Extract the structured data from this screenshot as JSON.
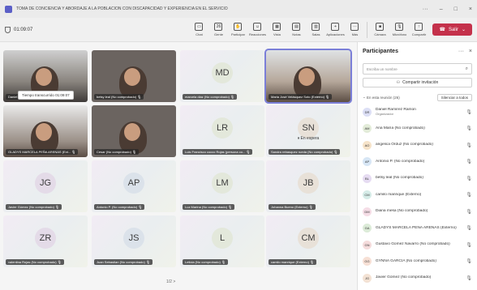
{
  "window": {
    "title": "TOMA DE CONCIENCIA Y ABORDAJE A LA POBLACIÓN CON DISCAPACIDAD Y EXPERIENCIA EN EL SERVICIO",
    "controls": {
      "more": "···",
      "minimize": "–",
      "maximize": "□",
      "close": "×"
    }
  },
  "toolbar": {
    "timer": "01:09:07",
    "buttons": [
      {
        "label": "Chat",
        "icon": "chat-icon",
        "glyph": "▭"
      },
      {
        "label": "Gente",
        "icon": "people-icon",
        "glyph": "26"
      },
      {
        "label": "Participar",
        "icon": "raise-hand-icon",
        "glyph": "✋"
      },
      {
        "label": "Reacciones",
        "icon": "smile-icon",
        "glyph": "☺"
      },
      {
        "label": "Vista",
        "icon": "grid-view-icon",
        "glyph": "▦"
      },
      {
        "label": "Notas",
        "icon": "notes-icon",
        "glyph": "▤"
      },
      {
        "label": "Salas",
        "icon": "rooms-icon",
        "glyph": "▥"
      },
      {
        "label": "Aplicaciones",
        "icon": "apps-icon",
        "glyph": "+"
      },
      {
        "label": "Más",
        "icon": "more-icon",
        "glyph": "···"
      }
    ],
    "devices": [
      {
        "label": "Cámara",
        "icon": "camera-icon",
        "glyph": "■"
      },
      {
        "label": "Micrófono",
        "icon": "microphone-icon",
        "glyph": "🎙"
      },
      {
        "label": "Compartir",
        "icon": "share-icon",
        "glyph": "↑"
      }
    ],
    "leave_label": "Salir",
    "leave_caret": "⌄"
  },
  "grid": {
    "tooltip": "Tiempo transcurrido 01:09:07",
    "waiting_label": "En espera",
    "pager": "1/2 >",
    "tiles": [
      {
        "name": "Daniel Ramírez Ramon",
        "initials": ""
      },
      {
        "name": "betsy leal (No comprobado)",
        "initials": ""
      },
      {
        "name": "marcela diaz (No comprobado)",
        "initials": "MD"
      },
      {
        "name": "Maria José Velásquez Soto (Externo)",
        "initials": ""
      },
      {
        "name": "GLADYS MARCELA PEÑA ARENAS (Ext...",
        "initials": ""
      },
      {
        "name": "Cesar (No comprobado)",
        "initials": ""
      },
      {
        "name": "Luis Francisco cocco Rojas (persona co...",
        "initials": "LR"
      },
      {
        "name": "Sandra rebasquez rueda (No comprobado)",
        "initials": "SN"
      },
      {
        "name": "Javier Gómez (No comprobado)",
        "initials": "JG"
      },
      {
        "name": "Antonio P. (No comprobado)",
        "initials": "AP"
      },
      {
        "name": "Luz Marina (No comprobado)",
        "initials": "LM"
      },
      {
        "name": "Johanna Bueno (Externo)",
        "initials": "JB"
      },
      {
        "name": "valentina Rojas (No comprobado)",
        "initials": "ZR"
      },
      {
        "name": "Juan Sebastian (No comprobado)",
        "initials": "JS"
      },
      {
        "name": "Leticia (No comprobado)",
        "initials": "L"
      },
      {
        "name": "camilo manrique (Externo)",
        "initials": "CM"
      }
    ]
  },
  "panel": {
    "title": "Participantes",
    "search_placeholder": "Escriba un nombre",
    "share_label": "Compartir invitación",
    "section_label": "En esta reunión (26)",
    "mute_all_label": "Silenciar a todos",
    "participants": [
      {
        "initials": "DR",
        "name": "Daniel Ramírez Ramon",
        "role": "Organizador",
        "color": "#dcdff5"
      },
      {
        "initials": "AM",
        "name": "Ana María (No comprobado)",
        "role": "",
        "color": "#e3ecd9"
      },
      {
        "initials": "AO",
        "name": "angelica Orduz (No comprobado)",
        "role": "",
        "color": "#f6e3c9"
      },
      {
        "initials": "AP",
        "name": "Antonio P. (No comprobado)",
        "role": "",
        "color": "#d7e6f5"
      },
      {
        "initials": "BL",
        "name": "betsy leal (No comprobado)",
        "role": "",
        "color": "#e6dcf2"
      },
      {
        "initials": "CM",
        "name": "camilo manrique (Externo)",
        "role": "",
        "color": "#d6ece8"
      },
      {
        "initials": "DM",
        "name": "Diana mesa (No comprobado)",
        "role": "",
        "color": "#f5dde6"
      },
      {
        "initials": "GA",
        "name": "GLADYS MARCELA PEÑA ARENAS (Externo)",
        "role": "",
        "color": "#dcebd8"
      },
      {
        "initials": "GN",
        "name": "Gustavo Gomez Navarro (No comprobado)",
        "role": "",
        "color": "#f5dcdc"
      },
      {
        "initials": "GG",
        "name": "GYNNA GARCIA (No comprobado)",
        "role": "",
        "color": "#f7e0d5"
      },
      {
        "initials": "JG",
        "name": "Javier Gómez (No comprobado)",
        "role": "",
        "color": "#f3e2d4"
      }
    ]
  }
}
